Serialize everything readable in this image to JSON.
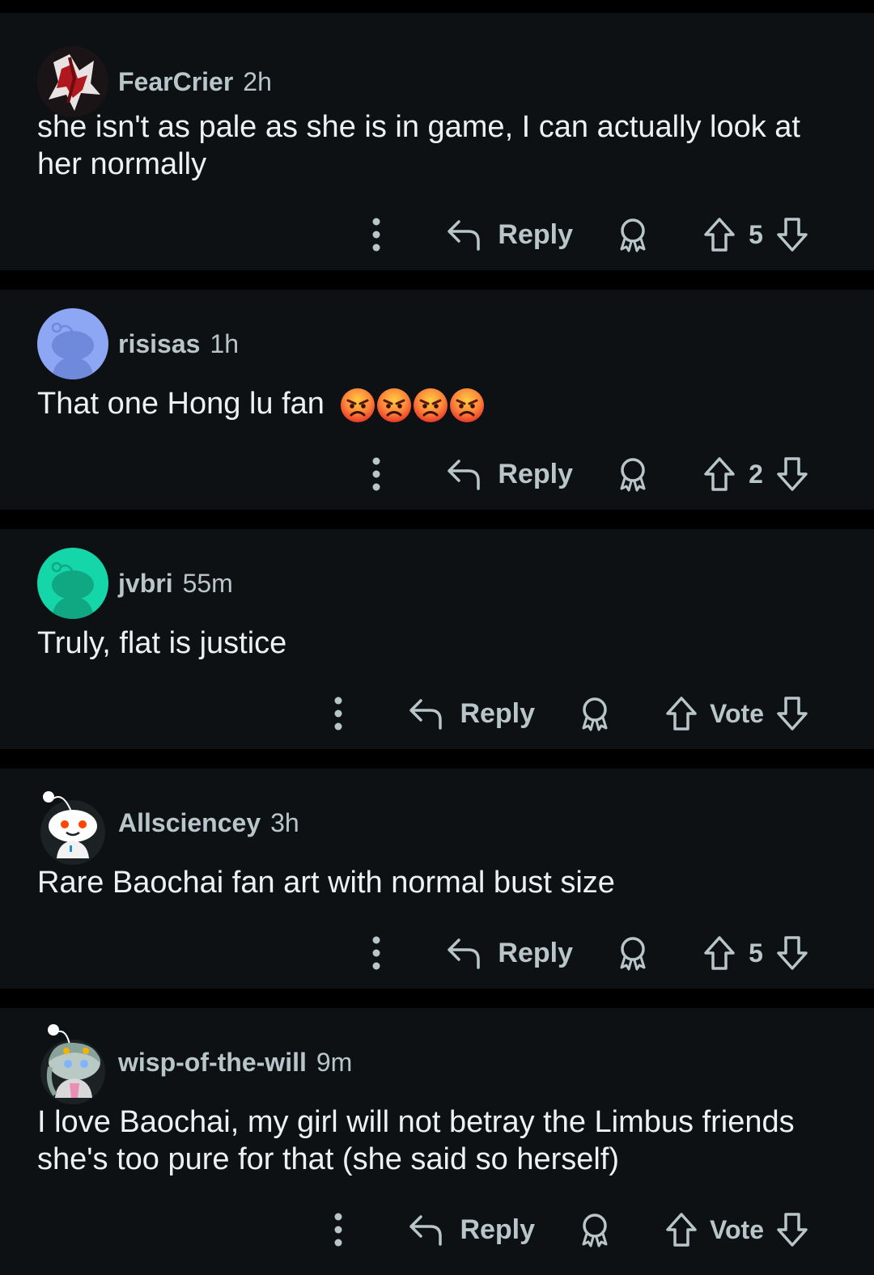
{
  "comments": [
    {
      "username": "FearCrier",
      "time": "2h",
      "text": "she isn't as pale as she is in game, I can actually look at her normally",
      "reply_label": "Reply",
      "votes": "5",
      "avatar_style": "custom-dark"
    },
    {
      "username": "risisas",
      "time": "1h",
      "text": "That one Hong lu fan",
      "emojis": [
        "angry-face",
        "angry-face",
        "angry-face",
        "angry-face"
      ],
      "reply_label": "Reply",
      "votes": "2",
      "avatar_style": "default-blue"
    },
    {
      "username": "jvbri",
      "time": "55m",
      "text": "Truly, flat is justice",
      "reply_label": "Reply",
      "votes": "Vote",
      "avatar_style": "default-teal"
    },
    {
      "username": "Allsciencey",
      "time": "3h",
      "text": "Rare Baochai fan art with normal bust size",
      "reply_label": "Reply",
      "votes": "5",
      "avatar_style": "snoo-white"
    },
    {
      "username": "wisp-of-the-will",
      "time": "9m",
      "text": "I love Baochai, my girl will not betray the Limbus friends she's too pure for that (she said so herself)",
      "reply_label": "Reply",
      "votes": "Vote",
      "avatar_style": "snoo-custom"
    }
  ],
  "colors": {
    "background": "#000000",
    "card": "#0e1113",
    "meta_text": "#b8c5c9",
    "body_text": "#eef1f3",
    "avatar_blue": "#8ea7f5",
    "avatar_teal": "#14d6a8"
  },
  "icons": {
    "more": "more-vertical-icon",
    "reply": "reply-arrow-icon",
    "award": "award-ribbon-icon",
    "upvote": "upvote-arrow-icon",
    "downvote": "downvote-arrow-icon"
  }
}
